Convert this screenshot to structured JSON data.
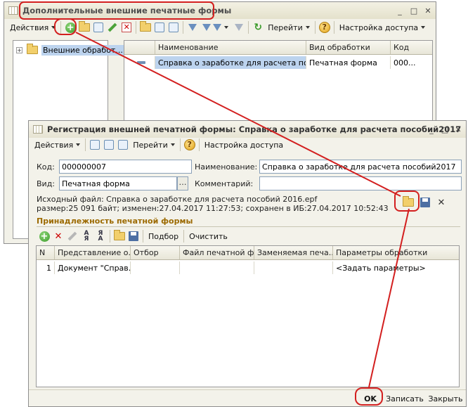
{
  "window1": {
    "title": "Дополнительные внешние печатные формы",
    "toolbar": {
      "actions": "Действия",
      "goto": "Перейти",
      "access": "Настройка доступа"
    },
    "tree": {
      "root": "Внешние обработ..."
    },
    "grid": {
      "headers": [
        "Наименование",
        "Вид обработки",
        "Код"
      ],
      "rows": [
        {
          "name": "Справка о заработке для расчета посо...",
          "kind": "Печатная форма",
          "code": "000..."
        }
      ]
    }
  },
  "window2": {
    "title": "Регистрация внешней печатной формы: Справка о заработке для расчета пособий2017",
    "toolbar": {
      "actions": "Действия",
      "goto": "Перейти",
      "access": "Настройка доступа"
    },
    "form": {
      "code_label": "Код:",
      "code_value": "000000007",
      "name_label": "Наименование:",
      "name_value": "Справка о заработке для расчета пособий2017",
      "kind_label": "Вид:",
      "kind_value": "Печатная форма",
      "comment_label": "Комментарий:",
      "comment_value": "",
      "source_line1": "Исходный файл: Справка о заработке для расчета пособий 2016.epf",
      "source_line2": "размер:25 091 байт; изменен:27.04.2017 11:27:53; сохранен в ИБ:27.04.2017 10:52:43"
    },
    "section_title": "Принадлежность печатной формы",
    "table_toolbar": {
      "select": "Подбор",
      "clear": "Очистить"
    },
    "table": {
      "headers": [
        "N",
        "Представление о...",
        "Отбор",
        "Файл печатной ф...",
        "Заменяемая печа...",
        "Параметры обработки"
      ],
      "rows": [
        {
          "n": "1",
          "repr": "Документ \"Справ...",
          "filter": "",
          "file": "",
          "replace": "",
          "params": "<Задать параметры>"
        }
      ]
    },
    "buttons": {
      "ok": "OK",
      "save": "Записать",
      "close": "Закрыть"
    }
  },
  "annotation_color": "#d31f1f"
}
